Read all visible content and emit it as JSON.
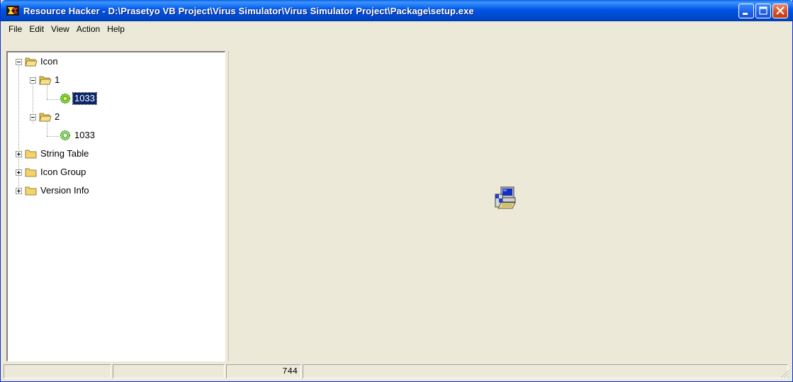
{
  "window": {
    "title": "Resource Hacker  -  D:\\Prasetyo VB Project\\Virus Simulator\\Virus Simulator Project\\Package\\setup.exe",
    "app_icon": "resource-hacker-icon"
  },
  "menu": {
    "items": [
      "File",
      "Edit",
      "View",
      "Action",
      "Help"
    ]
  },
  "tree": {
    "nodes": [
      {
        "label": "Icon",
        "icon": "open-folder-icon",
        "expanded": true
      },
      {
        "label": "1",
        "icon": "open-folder-icon",
        "expanded": true
      },
      {
        "label": "1033",
        "icon": "gear-resource-icon",
        "selected": true
      },
      {
        "label": "2",
        "icon": "open-folder-icon",
        "expanded": true
      },
      {
        "label": "1033",
        "icon": "gear-resource-icon",
        "selected": false
      },
      {
        "label": "String Table",
        "icon": "closed-folder-icon",
        "expanded": false
      },
      {
        "label": "Icon Group",
        "icon": "closed-folder-icon",
        "expanded": false
      },
      {
        "label": "Version Info",
        "icon": "closed-folder-icon",
        "expanded": false
      }
    ]
  },
  "preview": {
    "icon": "setup-installer-icon"
  },
  "status": {
    "cells": [
      "",
      "",
      "744",
      ""
    ]
  },
  "colors": {
    "titlebar": "#0055e5",
    "selection": "#0a246a",
    "close_button": "#d84a22",
    "folder": "#f4d46a",
    "gear": "#6ed23a"
  }
}
